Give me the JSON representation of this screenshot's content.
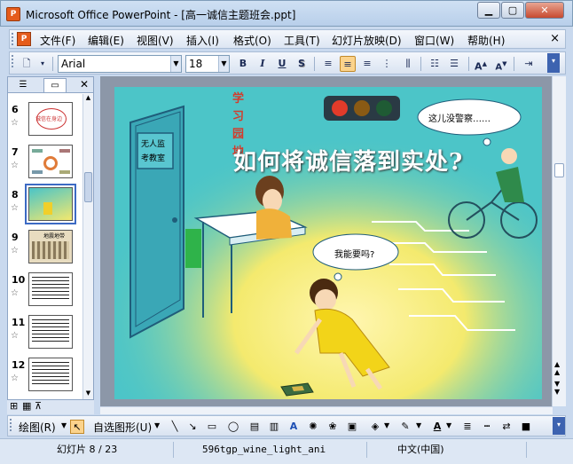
{
  "window": {
    "app_icon": "P",
    "title": "Microsoft Office PowerPoint - [高一诚信主题班会.ppt]"
  },
  "menubar": {
    "doc_icon": "P",
    "items": [
      "文件(F)",
      "编辑(E)",
      "视图(V)",
      "插入(I)",
      "格式(O)",
      "工具(T)",
      "幻灯片放映(D)",
      "窗口(W)",
      "帮助(H)"
    ],
    "close": "×"
  },
  "toolbar": {
    "font": "Arial",
    "size": "18",
    "bold": "B",
    "italic": "I",
    "underline": "U",
    "shadow": "S"
  },
  "left_pane": {
    "slides": [
      {
        "num": "6",
        "text": "诚信在身边"
      },
      {
        "num": "7",
        "text": ""
      },
      {
        "num": "8",
        "text": ""
      },
      {
        "num": "9",
        "text": "地震地带"
      },
      {
        "num": "10",
        "text": ""
      },
      {
        "num": "11",
        "text": ""
      },
      {
        "num": "12",
        "text": ""
      }
    ]
  },
  "slide": {
    "title": "如何将诚信落到实处?",
    "side_text": "学习园地",
    "bubble_top": "这儿没警察……",
    "bubble_mid": "我能要吗?",
    "door_sign": [
      "无人监",
      "考教室"
    ]
  },
  "drawbar": {
    "draw_label": "绘图(R)",
    "autoshapes_label": "自选图形(U)"
  },
  "status": {
    "slide_info": "幻灯片 8 / 23",
    "template": "596tgp_wine_light_ani",
    "language": "中文(中国)"
  }
}
